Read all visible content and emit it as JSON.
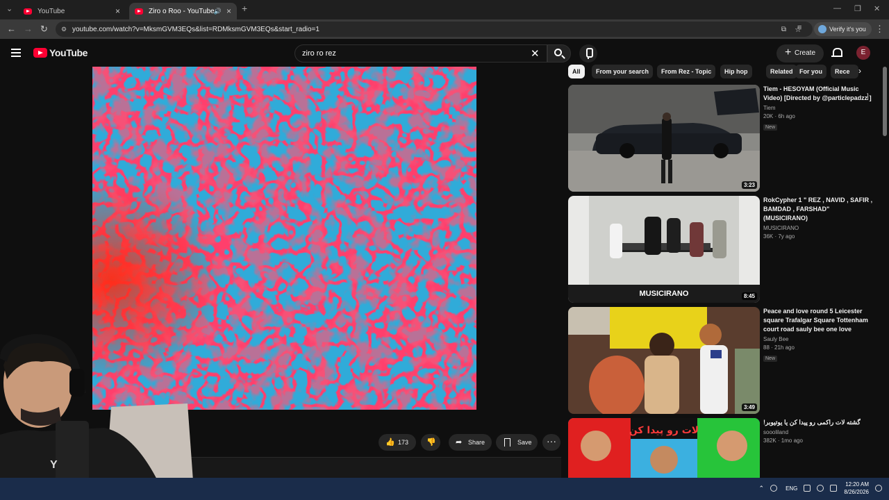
{
  "browser": {
    "tabs": [
      {
        "title": "YouTube"
      },
      {
        "title": "Ziro o Roo - YouTube"
      }
    ],
    "url": "youtube.com/watch?v=MksmGVM3EQs&list=RDMksmGVM3EQs&start_radio=1",
    "verify_label": "Verify it's you"
  },
  "header": {
    "logo_text": "YouTube",
    "search_value": "ziro ro rez",
    "create_label": "Create",
    "avatar_letter": "E"
  },
  "actions": {
    "like_count": "173",
    "share_label": "Share",
    "save_label": "Save"
  },
  "chips": [
    "All",
    "From your search",
    "From Rez - Topic",
    "Hip hop",
    "Related",
    "For you",
    "Rece"
  ],
  "recommendations": [
    {
      "title": "Tiem - HESOYAM (Official Music Video) [Directed by @particlepadzz ]",
      "channel": "Tiem",
      "stats": "20K · 6h ago",
      "badge": "New",
      "duration": "3:23"
    },
    {
      "title": "RokCypher 1 \" REZ , NAVID , SAFIR , BAMDAD , FARSHAD\" (MUSICIRANO)",
      "channel": "MUSICIRANO",
      "stats": "36K · 7y ago",
      "badge": "",
      "duration": "8:45"
    },
    {
      "title": "Peace and love round 5 Leicester square Trafalgar Square Tottenham court road sauly bee one love",
      "channel": "Sauly Bee",
      "stats": "88 · 21h ago",
      "badge": "New",
      "duration": "3:49"
    },
    {
      "title": "گشته لات راکمی رو پیدا کن یا یوتیوبر!",
      "channel": "soooliland",
      "stats": "382K · 1mo ago",
      "badge": "",
      "duration": ""
    }
  ],
  "thumb_text": {
    "musicirano": "MUSICIRANO",
    "persian": "لات رو پیدا کن"
  },
  "taskbar": {
    "lang": "ENG",
    "time": "12:20 AM",
    "date": "8/26/2026"
  },
  "colors": {
    "brand_red": "#ff0033",
    "bg": "#0f0f0f"
  }
}
